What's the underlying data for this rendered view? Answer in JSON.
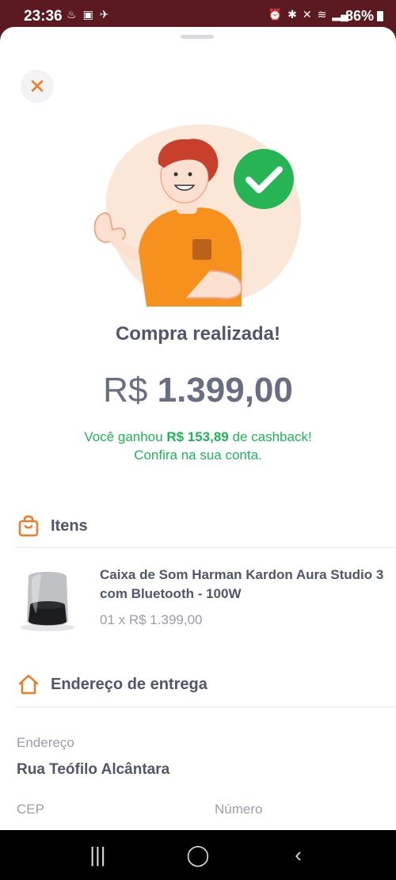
{
  "status_bar": {
    "time": "23:36",
    "battery": "86%",
    "left_icons": [
      "notification-icon",
      "image-icon",
      "activity-icon"
    ],
    "right_icons": [
      "alarm-icon",
      "bluetooth-icon",
      "mute-icon",
      "wifi-icon",
      "signal-icon"
    ]
  },
  "header": {
    "close_icon": "close-icon"
  },
  "confirmation": {
    "title": "Compra realizada!",
    "currency": "R$",
    "amount": "1.399,00",
    "cashback_prefix": "Você ganhou ",
    "cashback_value": "R$ 153,89",
    "cashback_suffix": " de cashback!",
    "cashback_line2": "Confira na sua conta."
  },
  "items_section": {
    "title": "Itens",
    "icon": "shopping-bag-icon",
    "items": [
      {
        "name": "Caixa de Som Harman Kardon Aura Studio 3 com Bluetooth - 100W",
        "quantity_price": "01 x R$ 1.399,00"
      }
    ]
  },
  "delivery_section": {
    "title": "Endereço de entrega",
    "icon": "home-icon",
    "address_label": "Endereço",
    "address_value": "Rua Teófilo Alcântara",
    "cep_label": "CEP",
    "number_label": "Número"
  },
  "nav_bar": {
    "recents": "|||",
    "home": "◯",
    "back": "‹"
  },
  "colors": {
    "accent_orange": "#f07b22",
    "success_green": "#21b357",
    "text_dark": "#51566a",
    "text_muted": "#9a9dad"
  }
}
